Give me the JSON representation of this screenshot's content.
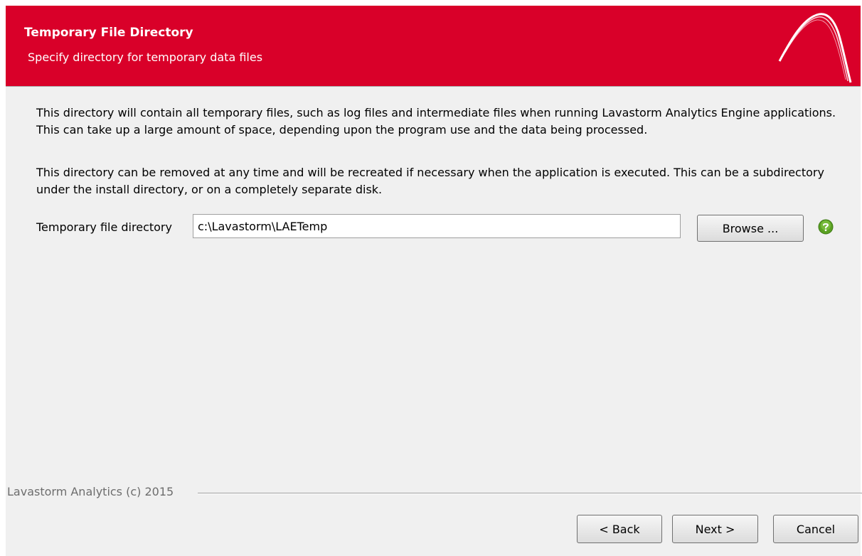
{
  "header": {
    "title": "Temporary File Directory",
    "subtitle": "Specify directory for temporary data files",
    "logo_icon": "lavastorm-arc-logo"
  },
  "body": {
    "paragraph1": "This directory will contain all temporary files, such as log files and intermediate files when running Lavastorm Analytics Engine applications. This can take up a large amount of space, depending upon the program use and the data being processed.",
    "paragraph2": "This directory can be removed at any time and will be recreated if necessary when the application is executed. This can be a subdirectory under the install directory, or on a completely separate disk."
  },
  "field": {
    "label": "Temporary file directory",
    "value": "c:\\Lavastorm\\LAETemp",
    "browse_label": "Browse ...",
    "help_icon": "help-icon"
  },
  "footer": {
    "copyright": "Lavastorm Analytics (c) 2015",
    "back_label": "< Back",
    "next_label": "Next >",
    "cancel_label": "Cancel"
  },
  "colors": {
    "header_bg": "#d90029",
    "header_text": "#ffffff",
    "content_bg": "#f0f0f0",
    "help_green": "#5aa022"
  }
}
